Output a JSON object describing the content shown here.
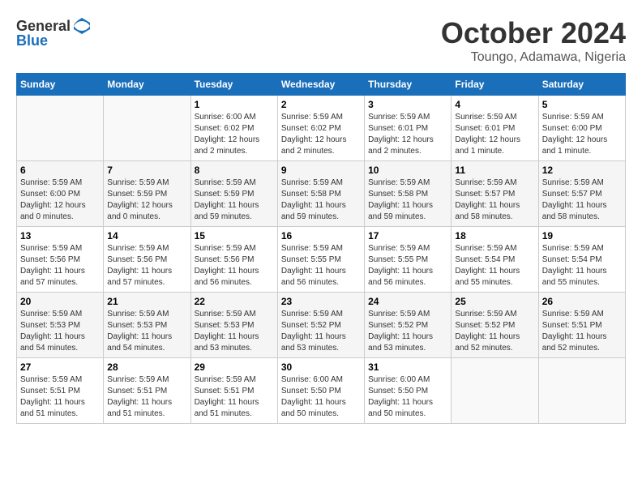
{
  "header": {
    "logo_general": "General",
    "logo_blue": "Blue",
    "month_title": "October 2024",
    "location": "Toungo, Adamawa, Nigeria"
  },
  "weekdays": [
    "Sunday",
    "Monday",
    "Tuesday",
    "Wednesday",
    "Thursday",
    "Friday",
    "Saturday"
  ],
  "weeks": [
    [
      {
        "day": null,
        "sunrise": null,
        "sunset": null,
        "daylight": null
      },
      {
        "day": null,
        "sunrise": null,
        "sunset": null,
        "daylight": null
      },
      {
        "day": "1",
        "sunrise": "Sunrise: 6:00 AM",
        "sunset": "Sunset: 6:02 PM",
        "daylight": "Daylight: 12 hours and 2 minutes."
      },
      {
        "day": "2",
        "sunrise": "Sunrise: 5:59 AM",
        "sunset": "Sunset: 6:02 PM",
        "daylight": "Daylight: 12 hours and 2 minutes."
      },
      {
        "day": "3",
        "sunrise": "Sunrise: 5:59 AM",
        "sunset": "Sunset: 6:01 PM",
        "daylight": "Daylight: 12 hours and 2 minutes."
      },
      {
        "day": "4",
        "sunrise": "Sunrise: 5:59 AM",
        "sunset": "Sunset: 6:01 PM",
        "daylight": "Daylight: 12 hours and 1 minute."
      },
      {
        "day": "5",
        "sunrise": "Sunrise: 5:59 AM",
        "sunset": "Sunset: 6:00 PM",
        "daylight": "Daylight: 12 hours and 1 minute."
      }
    ],
    [
      {
        "day": "6",
        "sunrise": "Sunrise: 5:59 AM",
        "sunset": "Sunset: 6:00 PM",
        "daylight": "Daylight: 12 hours and 0 minutes."
      },
      {
        "day": "7",
        "sunrise": "Sunrise: 5:59 AM",
        "sunset": "Sunset: 5:59 PM",
        "daylight": "Daylight: 12 hours and 0 minutes."
      },
      {
        "day": "8",
        "sunrise": "Sunrise: 5:59 AM",
        "sunset": "Sunset: 5:59 PM",
        "daylight": "Daylight: 11 hours and 59 minutes."
      },
      {
        "day": "9",
        "sunrise": "Sunrise: 5:59 AM",
        "sunset": "Sunset: 5:58 PM",
        "daylight": "Daylight: 11 hours and 59 minutes."
      },
      {
        "day": "10",
        "sunrise": "Sunrise: 5:59 AM",
        "sunset": "Sunset: 5:58 PM",
        "daylight": "Daylight: 11 hours and 59 minutes."
      },
      {
        "day": "11",
        "sunrise": "Sunrise: 5:59 AM",
        "sunset": "Sunset: 5:57 PM",
        "daylight": "Daylight: 11 hours and 58 minutes."
      },
      {
        "day": "12",
        "sunrise": "Sunrise: 5:59 AM",
        "sunset": "Sunset: 5:57 PM",
        "daylight": "Daylight: 11 hours and 58 minutes."
      }
    ],
    [
      {
        "day": "13",
        "sunrise": "Sunrise: 5:59 AM",
        "sunset": "Sunset: 5:56 PM",
        "daylight": "Daylight: 11 hours and 57 minutes."
      },
      {
        "day": "14",
        "sunrise": "Sunrise: 5:59 AM",
        "sunset": "Sunset: 5:56 PM",
        "daylight": "Daylight: 11 hours and 57 minutes."
      },
      {
        "day": "15",
        "sunrise": "Sunrise: 5:59 AM",
        "sunset": "Sunset: 5:56 PM",
        "daylight": "Daylight: 11 hours and 56 minutes."
      },
      {
        "day": "16",
        "sunrise": "Sunrise: 5:59 AM",
        "sunset": "Sunset: 5:55 PM",
        "daylight": "Daylight: 11 hours and 56 minutes."
      },
      {
        "day": "17",
        "sunrise": "Sunrise: 5:59 AM",
        "sunset": "Sunset: 5:55 PM",
        "daylight": "Daylight: 11 hours and 56 minutes."
      },
      {
        "day": "18",
        "sunrise": "Sunrise: 5:59 AM",
        "sunset": "Sunset: 5:54 PM",
        "daylight": "Daylight: 11 hours and 55 minutes."
      },
      {
        "day": "19",
        "sunrise": "Sunrise: 5:59 AM",
        "sunset": "Sunset: 5:54 PM",
        "daylight": "Daylight: 11 hours and 55 minutes."
      }
    ],
    [
      {
        "day": "20",
        "sunrise": "Sunrise: 5:59 AM",
        "sunset": "Sunset: 5:53 PM",
        "daylight": "Daylight: 11 hours and 54 minutes."
      },
      {
        "day": "21",
        "sunrise": "Sunrise: 5:59 AM",
        "sunset": "Sunset: 5:53 PM",
        "daylight": "Daylight: 11 hours and 54 minutes."
      },
      {
        "day": "22",
        "sunrise": "Sunrise: 5:59 AM",
        "sunset": "Sunset: 5:53 PM",
        "daylight": "Daylight: 11 hours and 53 minutes."
      },
      {
        "day": "23",
        "sunrise": "Sunrise: 5:59 AM",
        "sunset": "Sunset: 5:52 PM",
        "daylight": "Daylight: 11 hours and 53 minutes."
      },
      {
        "day": "24",
        "sunrise": "Sunrise: 5:59 AM",
        "sunset": "Sunset: 5:52 PM",
        "daylight": "Daylight: 11 hours and 53 minutes."
      },
      {
        "day": "25",
        "sunrise": "Sunrise: 5:59 AM",
        "sunset": "Sunset: 5:52 PM",
        "daylight": "Daylight: 11 hours and 52 minutes."
      },
      {
        "day": "26",
        "sunrise": "Sunrise: 5:59 AM",
        "sunset": "Sunset: 5:51 PM",
        "daylight": "Daylight: 11 hours and 52 minutes."
      }
    ],
    [
      {
        "day": "27",
        "sunrise": "Sunrise: 5:59 AM",
        "sunset": "Sunset: 5:51 PM",
        "daylight": "Daylight: 11 hours and 51 minutes."
      },
      {
        "day": "28",
        "sunrise": "Sunrise: 5:59 AM",
        "sunset": "Sunset: 5:51 PM",
        "daylight": "Daylight: 11 hours and 51 minutes."
      },
      {
        "day": "29",
        "sunrise": "Sunrise: 5:59 AM",
        "sunset": "Sunset: 5:51 PM",
        "daylight": "Daylight: 11 hours and 51 minutes."
      },
      {
        "day": "30",
        "sunrise": "Sunrise: 6:00 AM",
        "sunset": "Sunset: 5:50 PM",
        "daylight": "Daylight: 11 hours and 50 minutes."
      },
      {
        "day": "31",
        "sunrise": "Sunrise: 6:00 AM",
        "sunset": "Sunset: 5:50 PM",
        "daylight": "Daylight: 11 hours and 50 minutes."
      },
      {
        "day": null,
        "sunrise": null,
        "sunset": null,
        "daylight": null
      },
      {
        "day": null,
        "sunrise": null,
        "sunset": null,
        "daylight": null
      }
    ]
  ]
}
